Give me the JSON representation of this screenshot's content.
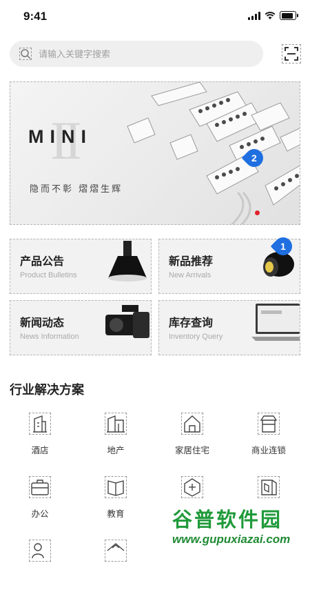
{
  "status_bar": {
    "time": "9:41"
  },
  "search": {
    "placeholder": "请输入关键字搜索"
  },
  "banner": {
    "title": "MINI",
    "roman_numeral": "II",
    "subtitle": "隐而不彰 熠熠生辉",
    "badge": "2"
  },
  "cards": [
    {
      "title": "产品公告",
      "subtitle": "Product Bulletins"
    },
    {
      "title": "新品推荐",
      "subtitle": "New Arrivals",
      "badge": "1"
    },
    {
      "title": "新闻动态",
      "subtitle": "News Information"
    },
    {
      "title": "库存查询",
      "subtitle": "Inventory Query"
    }
  ],
  "solutions": {
    "title": "行业解决方案",
    "items": [
      {
        "label": "酒店",
        "icon": "hotel-icon"
      },
      {
        "label": "地产",
        "icon": "real-estate-icon"
      },
      {
        "label": "家居住宅",
        "icon": "home-icon"
      },
      {
        "label": "商业连锁",
        "icon": "store-icon"
      },
      {
        "label": "办公",
        "icon": "briefcase-icon"
      },
      {
        "label": "教育",
        "icon": "book-icon"
      },
      {
        "label": "",
        "icon": "medical-icon"
      },
      {
        "label": "",
        "icon": "gallery-icon"
      },
      {
        "label": "",
        "icon": "person-icon"
      },
      {
        "label": "",
        "icon": "house-icon"
      }
    ]
  },
  "watermark": {
    "text": "谷普软件园",
    "url": "www.gupuxiazai.com"
  },
  "colors": {
    "badge": "#1f6fe0",
    "watermark": "#1f9a3a",
    "card_bg": "#f2f2f2"
  }
}
